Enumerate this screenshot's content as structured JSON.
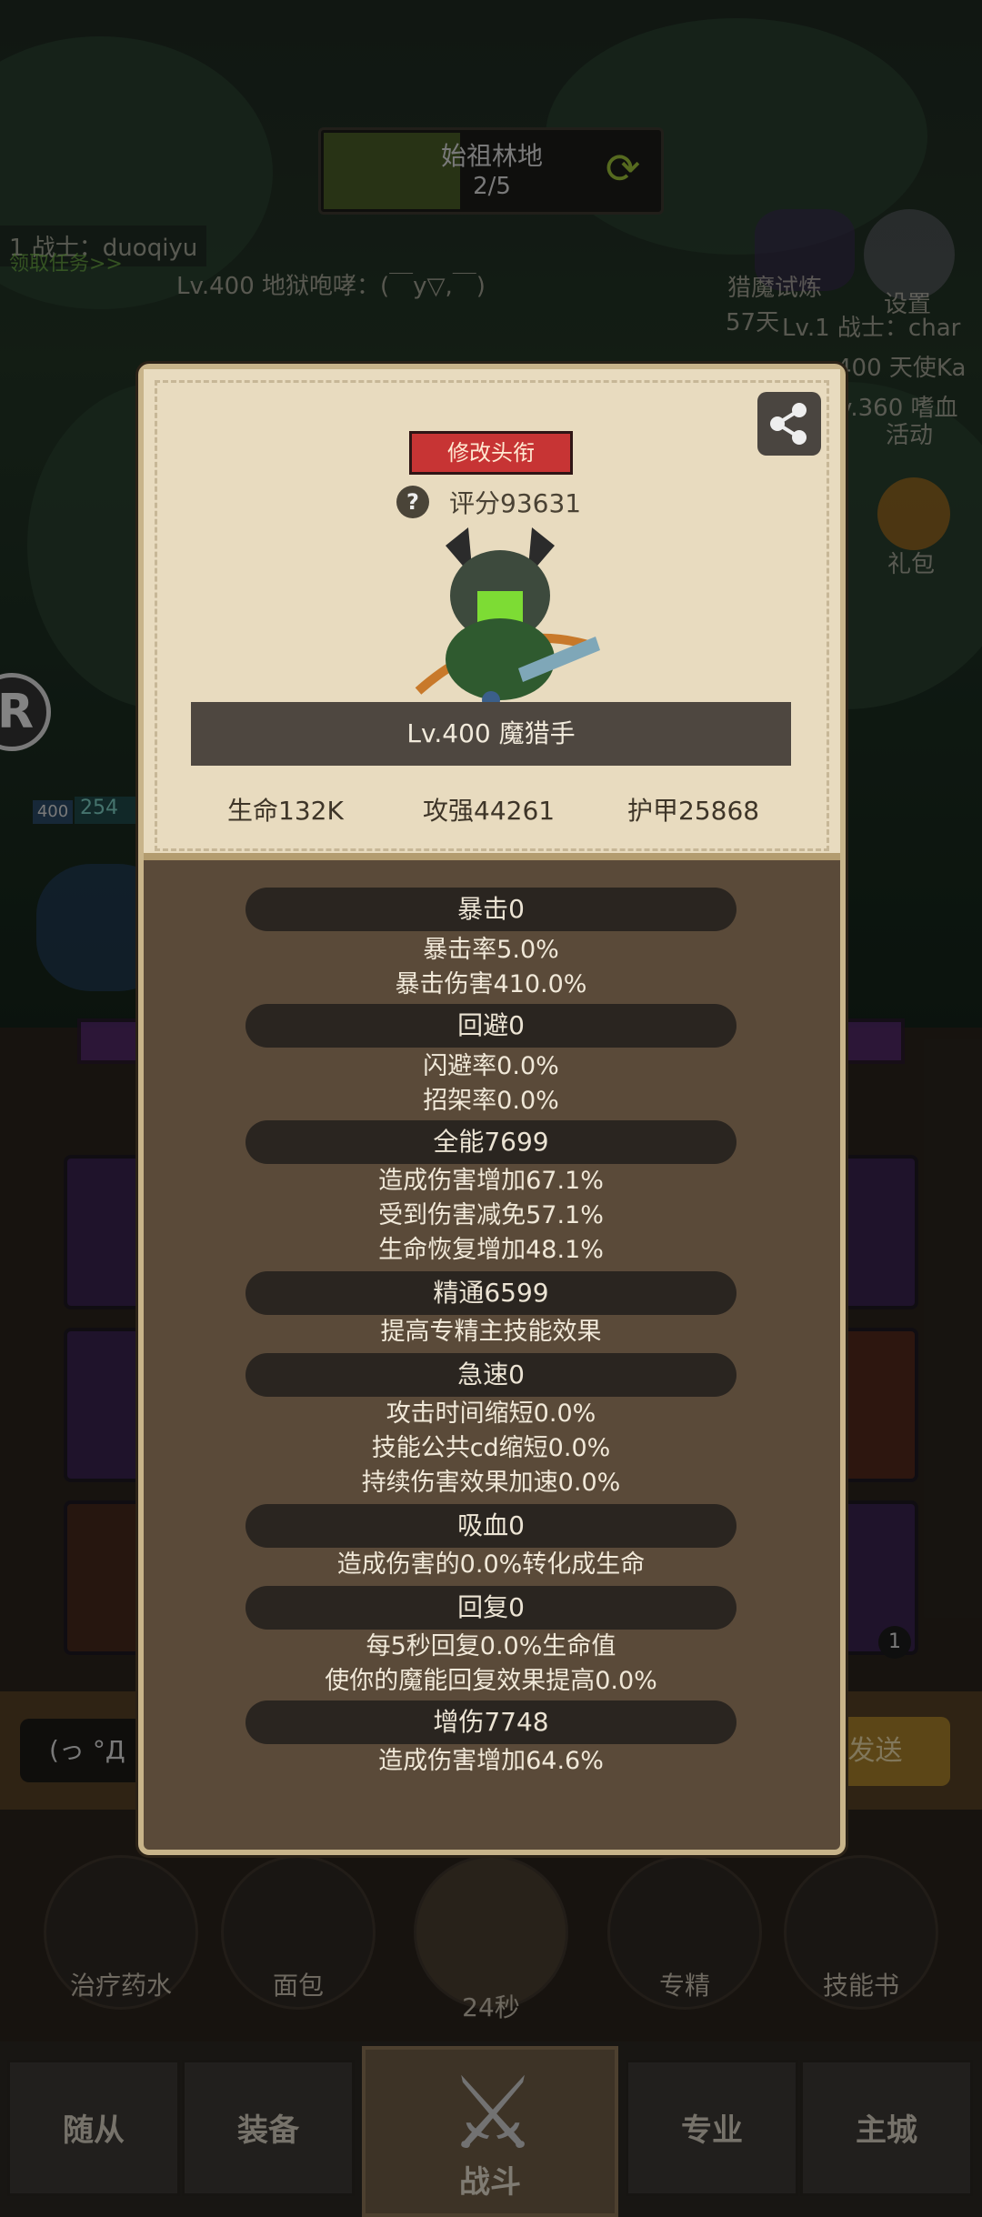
{
  "background": {
    "zone_name": "始祖林地",
    "zone_progress": "2/5",
    "top_left_line1": "1 战士：duoqiyu",
    "top_left_line2": "领取任务>>",
    "top_chat": "Lv.400 地狱咆哮：(￣y▽,￣)",
    "right_trial": "猎魔试炼",
    "right_trial_time": "57天",
    "right_settings": "设置",
    "right_activity": "活动",
    "right_gift": "礼包",
    "right_chat1": "Lv.1 战士：char",
    "right_chat2": "400 天使Ka",
    "right_chat3": "v.360 嗜血",
    "left_level_tag": "400",
    "left_hp": "254",
    "chat_input": "(っ °Д °",
    "send_label": "发送",
    "slot_badge": "1",
    "items": [
      "治疗药水",
      "面包",
      "24秒",
      "专精",
      "技能书"
    ]
  },
  "bottom_nav": [
    "随从",
    "装备",
    "战斗",
    "专业",
    "主城"
  ],
  "modal": {
    "title_button": "修改头衔",
    "score": "评分93631",
    "hero_name": "Lv.400 魔猎手",
    "stats": [
      "生命132K",
      "攻强44261",
      "护甲25868"
    ],
    "sections": [
      {
        "header": "暴击0",
        "lines": [
          "暴击率5.0%",
          "暴击伤害410.0%"
        ]
      },
      {
        "header": "回避0",
        "lines": [
          "闪避率0.0%",
          "招架率0.0%"
        ]
      },
      {
        "header": "全能7699",
        "lines": [
          "造成伤害增加67.1%",
          "受到伤害减免57.1%",
          "生命恢复增加48.1%"
        ]
      },
      {
        "header": "精通6599",
        "lines": [
          "提高专精主技能效果"
        ]
      },
      {
        "header": "急速0",
        "lines": [
          "攻击时间缩短0.0%",
          "技能公共cd缩短0.0%",
          "持续伤害效果加速0.0%"
        ]
      },
      {
        "header": "吸血0",
        "lines": [
          "造成伤害的0.0%转化成生命"
        ]
      },
      {
        "header": "回复0",
        "lines": [
          "每5秒回复0.0%生命值",
          "使你的魔能回复效果提高0.0%"
        ]
      },
      {
        "header": "增伤7748",
        "lines": [
          "造成伤害增加64.6%"
        ]
      }
    ]
  }
}
